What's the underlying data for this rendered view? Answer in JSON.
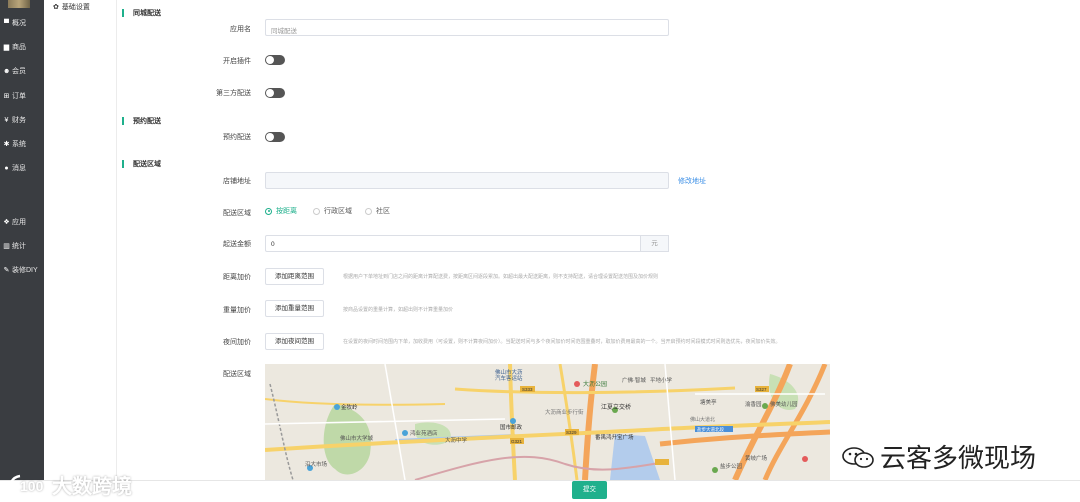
{
  "sidebar": {
    "items": [
      {
        "label": "概况",
        "icon": "monitor-icon"
      },
      {
        "label": "商品",
        "icon": "box-icon"
      },
      {
        "label": "会员",
        "icon": "users-icon"
      },
      {
        "label": "订单",
        "icon": "cart-icon"
      },
      {
        "label": "财务",
        "icon": "yen-icon"
      },
      {
        "label": "系统",
        "icon": "gears-icon"
      },
      {
        "label": "消息",
        "icon": "chat-icon"
      },
      {
        "label": "应用",
        "icon": "apps-icon"
      },
      {
        "label": "统计",
        "icon": "barchart-icon"
      },
      {
        "label": "装修DIY",
        "icon": "brush-icon"
      }
    ]
  },
  "subnav": {
    "item": "基础设置",
    "icon": "gear-icon"
  },
  "sections": {
    "city": "同城配送",
    "reserve": "预约配送",
    "area": "配送区域"
  },
  "form": {
    "app_name_label": "应用名",
    "app_name_placeholder": "同城配送",
    "plugin_label": "开启插件",
    "third_party_label": "第三方配送",
    "reserve_label": "预约配送",
    "store_address_label": "店铺地址",
    "store_address_link": "修改地址",
    "delivery_area_label": "配送区域",
    "area_options": [
      "按距离",
      "行政区域",
      "社区"
    ],
    "min_amount_label": "起送金额",
    "min_amount_value": "0",
    "min_amount_suffix": "元",
    "distance_label": "距离加价",
    "distance_button": "添加距离范围",
    "distance_hint": "根据用户下单地址到门店之间的距离计算配送费，按距离区间逐段累加。如超出最大配送距离，则不支持配送，请合理设置配送范围及加价规则",
    "weight_label": "重量加价",
    "weight_button": "添加重量范围",
    "weight_hint": "按商品设置的重量计算，如超出则不计算重量加价",
    "night_label": "夜间加价",
    "night_button": "添加夜间范围",
    "night_hint": "在设置的夜间时间范围内下单，加收费用（可设置，则不计算夜间加价）。当配送时间与多个夜间加价时间范围重叠时，取加价费用最高的一个。当开启预约时间段模式时间则选优先，夜间加价失效。",
    "map_label": "配送区域"
  },
  "map": {
    "labels": [
      "佛山市大沥汽车客运站",
      "大沥公园",
      "广佛·智城",
      "平地小学",
      "江夏立交桥",
      "金牧岭",
      "国市邮政",
      "大沥商业步行街",
      "番禺鸿升宝广场",
      "佛山市大学城",
      "鸿业苑酒店",
      "大沥中学",
      "沿大市场",
      "渝香园",
      "盐步公园",
      "佛美幼儿园",
      "塘美亭",
      "黄岐广场",
      "佛山大道北",
      "盐步大道北段"
    ],
    "roads": [
      "S333",
      "S329",
      "G321",
      "S327"
    ]
  },
  "footer": {
    "submit": "提交"
  },
  "watermarks": {
    "left": "大数跨境",
    "right": "云客多微现场"
  }
}
